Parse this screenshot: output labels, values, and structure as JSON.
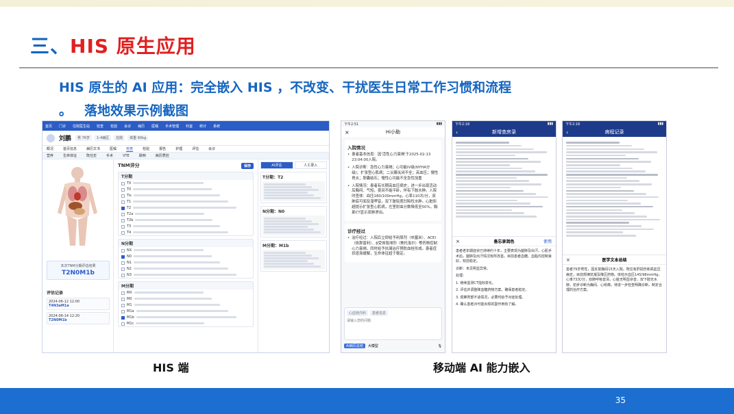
{
  "slide": {
    "title_prefix": "三、",
    "title_main": "HIS 原生应用",
    "subhead1": "HIS 原生的 AI 应用：完全嵌入 HIS ，不改变、干扰医生日常工作习惯和流程",
    "subhead2_bullet": "。",
    "subhead2": "落地效果示例截图",
    "caption_his": "HIS 端",
    "caption_mobile": "移动端 AI 能力嵌入",
    "page_number": "35"
  },
  "his_screen": {
    "nav_items": [
      "首页",
      "门诊",
      "住院医生站",
      "检查",
      "检验",
      "会诊",
      "病历",
      "医嘱",
      "手术管理",
      "科室",
      "统计",
      "系统"
    ],
    "patient_name": "刘鹏",
    "patient_chips": [
      "男 76岁",
      "1-4病区",
      "在院",
      "体重 60kg"
    ],
    "tabs_primary": [
      "概况",
      "首页信息",
      "病历文书",
      "医嘱",
      "检查",
      "检验",
      "报告",
      "护理",
      "评估",
      "会诊"
    ],
    "tabs_secondary": [
      "营养",
      "生命体征",
      "既往史",
      "手术",
      "VTE",
      "跌倒",
      "病历质控"
    ],
    "result_label": "本次TNM分期评估结果",
    "result_value": "T2N0M1b",
    "eval_title": "评估记录",
    "eval_items": [
      {
        "date": "2024-06-12 12:00",
        "value": "T4N3aM1a"
      },
      {
        "date": "2024-06-14 12:20",
        "value": "T2N0M1b"
      }
    ],
    "panel_title": "TNM评分",
    "panel_button": "保存",
    "sections": [
      {
        "title": "T分期",
        "options": [
          "TX",
          "T0",
          "Tis",
          "T1",
          "T2",
          "T2a",
          "T2b",
          "T3",
          "T4"
        ],
        "checked": [
          4
        ]
      },
      {
        "title": "N分期",
        "options": [
          "NX",
          "N0",
          "N1",
          "N2",
          "N3"
        ],
        "checked": [
          1
        ]
      },
      {
        "title": "M分期",
        "options": [
          "MX",
          "M0",
          "M1",
          "M1a",
          "M1b",
          "M1c"
        ],
        "checked": [
          4
        ]
      }
    ],
    "right_tabs": [
      "AI评估",
      "人工录入"
    ],
    "right_cards": [
      {
        "head": "T分期：",
        "value": "T2"
      },
      {
        "head": "N分期：",
        "value": "N0"
      },
      {
        "head": "M分期：",
        "value": "M1b"
      }
    ]
  },
  "mobile_chat": {
    "time": "下午2:51",
    "title": "Hi小助",
    "close_icon": "×",
    "section1": "入院情况",
    "bullets1": [
      "患者基本信息：因'活性心力衰竭'于2025-02-13 23:04:00入院。",
      "入院诊断：急性心力衰竭；心功能IV级(NYHA分级)；扩张型心肌病；二尖瓣关闭不全；高血压；慢性胃炎；胆囊结石；慢性心功能不全急性加重",
      "入院情况：患者有长期高血压病史，进一步出现活动后胸闷、气短，夜间不能平卧，伴有下肢水肿。入院时查体：血压180/100mmHg，心率110次/分，双肺底可闻及湿啰音，双下肢轻度凹陷性水肿。心脏彩超提示扩张型心肌病，左室射血分数降低至50%，胸部CT显示双肺渗出。"
    ],
    "section2": "诊疗经过",
    "bullets2": [
      "治疗经过：入院后立即给予利尿剂（呋塞米）、ACEI（依那普利）、β受体阻滞剂（美托洛尔）等药物控制心力衰竭，同时给予抗凝治疗预防血栓形成。患者症状逐渐缓解，生命体征趋于稳定。"
    ],
    "input_tag": "心血管内科",
    "input_patient": "患者信息",
    "input_placeholder": "请输入您的问题",
    "bottom_tags": [
      "AI病历总结",
      "大模型"
    ]
  },
  "mobile_doc1": {
    "time": "下午2:18",
    "title": "新增查房录",
    "overlay_title": "备忘录润色",
    "overlay_close": "×",
    "overlay_action": "使用",
    "overlay_paras": [
      "患者老年期症状已持续约十年，主要表现为腿肿及出汗。心肌手术后，腿肿及出汗情况有所改善。目前患者血糖、血脂均控制良好，较前稳定。",
      "诊断：未见明显异常。",
      "处理：",
      "1. 继续监测CT指标变化。",
      "2. 评估并调整降血糖药物方案，确保患者稳定。",
      "3. 观察胃部不适情况，必要时给予对症处理。",
      "4. 确认患者对可能出现的副作用有了解。"
    ]
  },
  "mobile_doc2": {
    "time": "下午2:18",
    "title": "病程记录",
    "overlay_title": "医学文本总结",
    "overlay_close": "×",
    "overlay_paras": [
      "患者79岁男性，因反复胸闷15天入院。既往有肝损伤和高血压病史，目前规律抗凝及降压药物。体检示血压145/98mmHg，心率73次/分，双肺呼吸音清，心脏无明显杂音，双下肢无水肿。初步诊断为胸闷、心绞痛，待进一步检查明确诊断，制定合理的治疗方案。"
    ]
  }
}
